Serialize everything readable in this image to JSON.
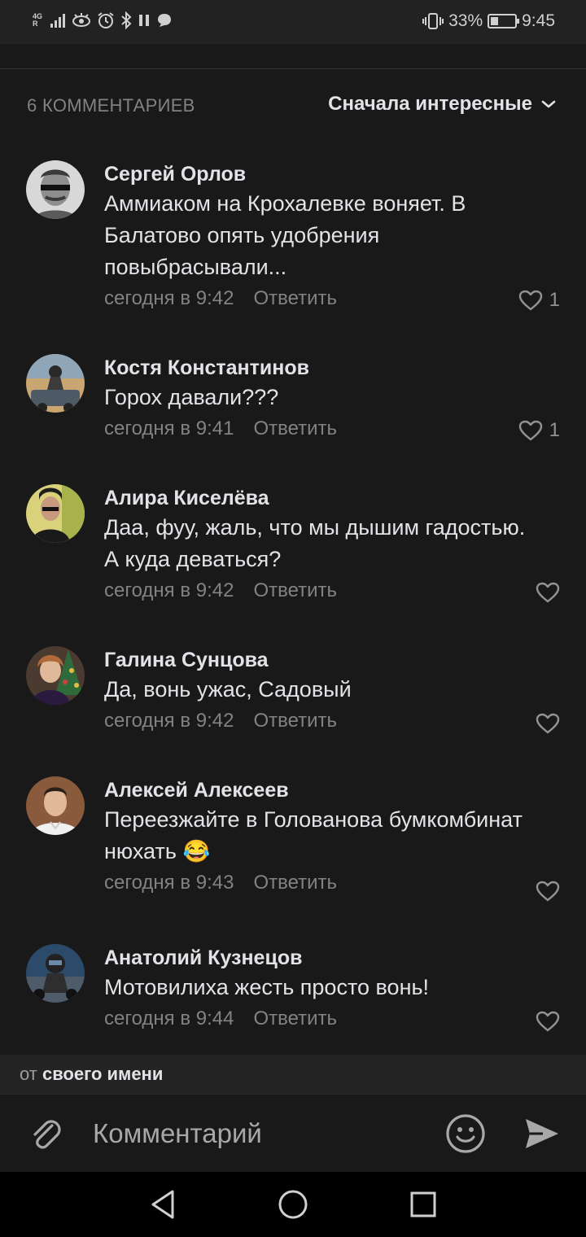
{
  "status_bar": {
    "network": "4G",
    "network_sub": "R",
    "battery_percent": "33%",
    "battery_level": 0.33,
    "time": "9:45"
  },
  "header": {
    "count": "6 КОММЕНТАРИЕВ",
    "sort": "Сначала интересные"
  },
  "comments": [
    {
      "author": "Сергей Орлов",
      "text": "Аммиаком на Крохалевке воняет. В Балатово опять удобрения повыбрасывали...",
      "time": "сегодня в 9:42",
      "reply": "Ответить",
      "likes": "1",
      "avatar_icon": "avatar-sunglasses-portrait"
    },
    {
      "author": "Костя Константинов",
      "text": "Горох давали???",
      "time": "сегодня в 9:41",
      "reply": "Ответить",
      "likes": "1",
      "avatar_icon": "avatar-vehicle-photo"
    },
    {
      "author": "Алира Киселёва",
      "text": "Даа, фуу, жаль, что мы дышим гадостью. А куда деваться?",
      "time": "сегодня в 9:42",
      "reply": "Ответить",
      "likes": "",
      "avatar_icon": "avatar-selfie-photo"
    },
    {
      "author": "Галина Сунцова",
      "text": "Да, вонь ужас, Садовый",
      "time": "сегодня в 9:42",
      "reply": "Ответить",
      "likes": "",
      "avatar_icon": "avatar-christmas-photo"
    },
    {
      "author": "Алексей Алексеев",
      "text": "Переезжайте в Голованова бумкомбинат нюхать",
      "emoji": "😂",
      "time": "сегодня в 9:43",
      "reply": "Ответить",
      "likes": "",
      "avatar_icon": "avatar-man-photo"
    },
    {
      "author": "Анатолий Кузнецов",
      "text": "Мотовилиха жесть просто вонь!",
      "time": "сегодня в 9:44",
      "reply": "Ответить",
      "likes": "",
      "avatar_icon": "avatar-motorcyclist-photo"
    }
  ],
  "author_bar": {
    "prefix": "от",
    "name": "своего имени"
  },
  "composer": {
    "placeholder": "Комментарий"
  },
  "colors": {
    "background": "#19191a",
    "text": "#e1e3e6",
    "secondary": "#828282"
  }
}
